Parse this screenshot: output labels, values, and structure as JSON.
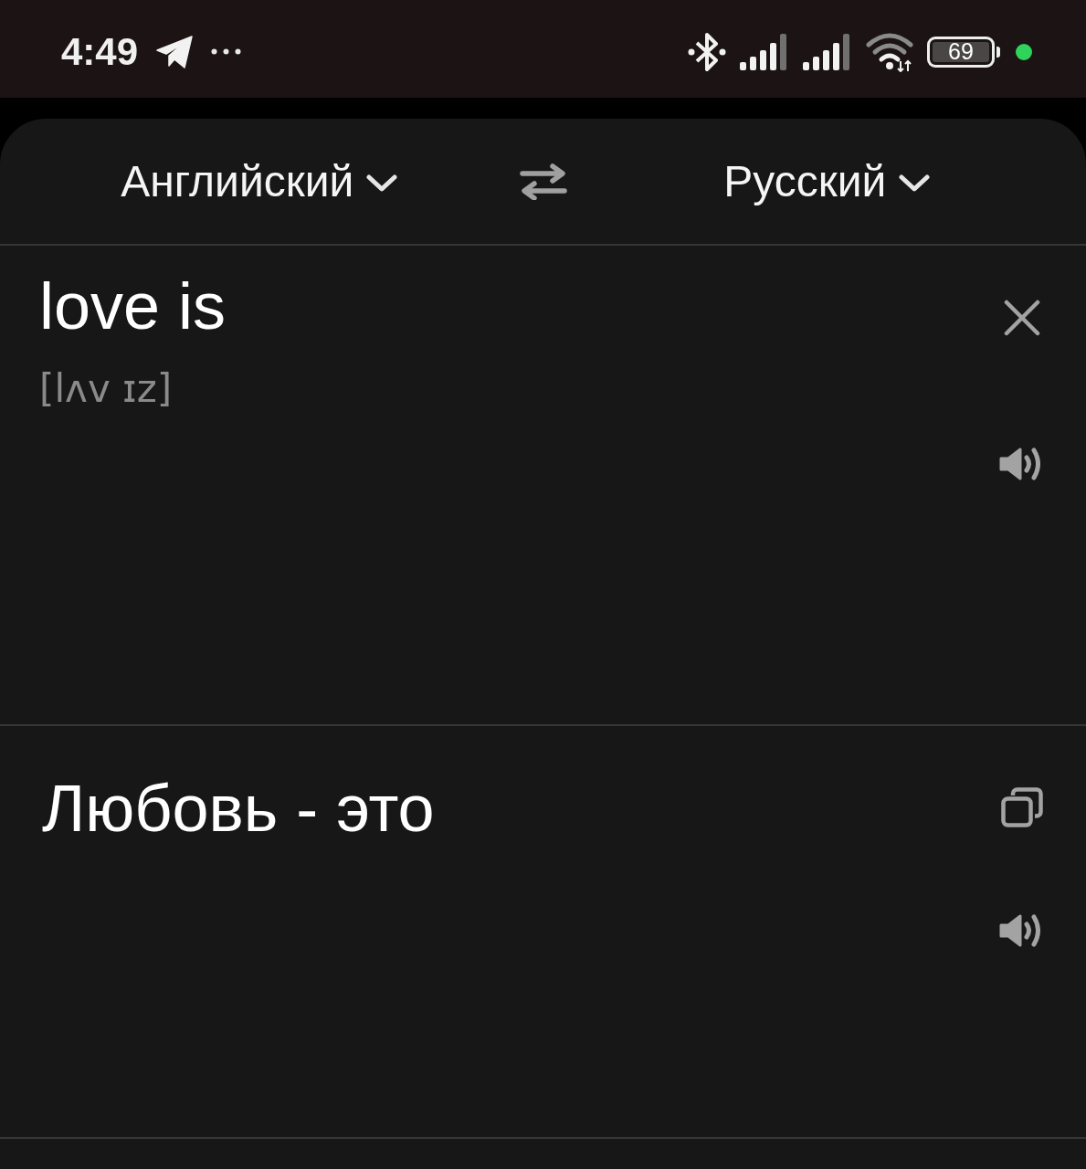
{
  "status_bar": {
    "time": "4:49",
    "battery_text": "69"
  },
  "language_bar": {
    "source": {
      "label": "Английский"
    },
    "target": {
      "label": "Русский"
    }
  },
  "input": {
    "text": "love is",
    "transcription": "[lʌv ɪz]"
  },
  "output": {
    "text": "Любовь - это"
  }
}
